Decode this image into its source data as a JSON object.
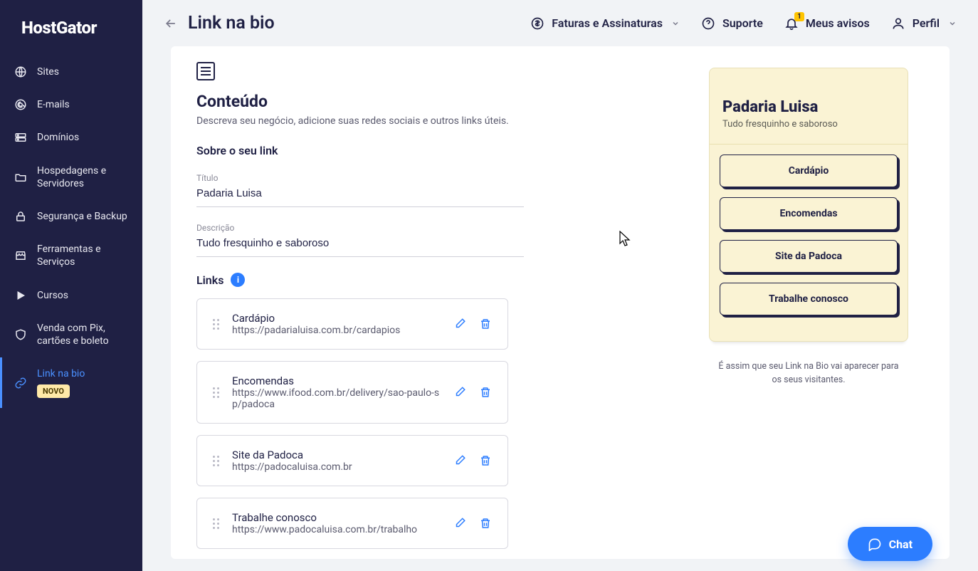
{
  "brand": "HostGator",
  "sidebar": {
    "items": [
      {
        "label": "Sites"
      },
      {
        "label": "E-mails"
      },
      {
        "label": "Domínios"
      },
      {
        "label": "Hospedagens e Servidores"
      },
      {
        "label": "Segurança e Backup"
      },
      {
        "label": "Ferramentas e Serviços"
      },
      {
        "label": "Cursos"
      },
      {
        "label": "Venda com Pix, cartões e boleto"
      },
      {
        "label": "Link na bio",
        "badge": "NOVO"
      }
    ]
  },
  "page_title": "Link na bio",
  "topnav": {
    "invoices": "Faturas e Assinaturas",
    "support": "Suporte",
    "notices": "Meus avisos",
    "notice_count": "1",
    "profile": "Perfil"
  },
  "content": {
    "section_title": "Conteúdo",
    "section_desc": "Descreva seu negócio, adicione suas redes sociais e outros links úteis.",
    "about_label": "Sobre o seu link",
    "title_label": "Título",
    "title_value": "Padaria Luisa",
    "desc_label": "Descrição",
    "desc_value": "Tudo fresquinho e saboroso",
    "links_label": "Links",
    "links": [
      {
        "name": "Cardápio",
        "url": "https://padarialuisa.com.br/cardapios"
      },
      {
        "name": "Encomendas",
        "url": "https://www.ifood.com.br/delivery/sao-paulo-sp/padoca"
      },
      {
        "name": "Site da Padoca",
        "url": "https://padocaluisa.com.br"
      },
      {
        "name": "Trabalhe conosco",
        "url": "https://www.padocaluisa.com.br/trabalho"
      }
    ]
  },
  "preview": {
    "title": "Padaria Luisa",
    "subtitle": "Tudo fresquinho e saboroso",
    "buttons": [
      "Cardápio",
      "Encomendas",
      "Site da Padoca",
      "Trabalhe conosco"
    ],
    "caption": "É assim que seu Link na Bio vai aparecer para os seus visitantes."
  },
  "chat_label": "Chat"
}
